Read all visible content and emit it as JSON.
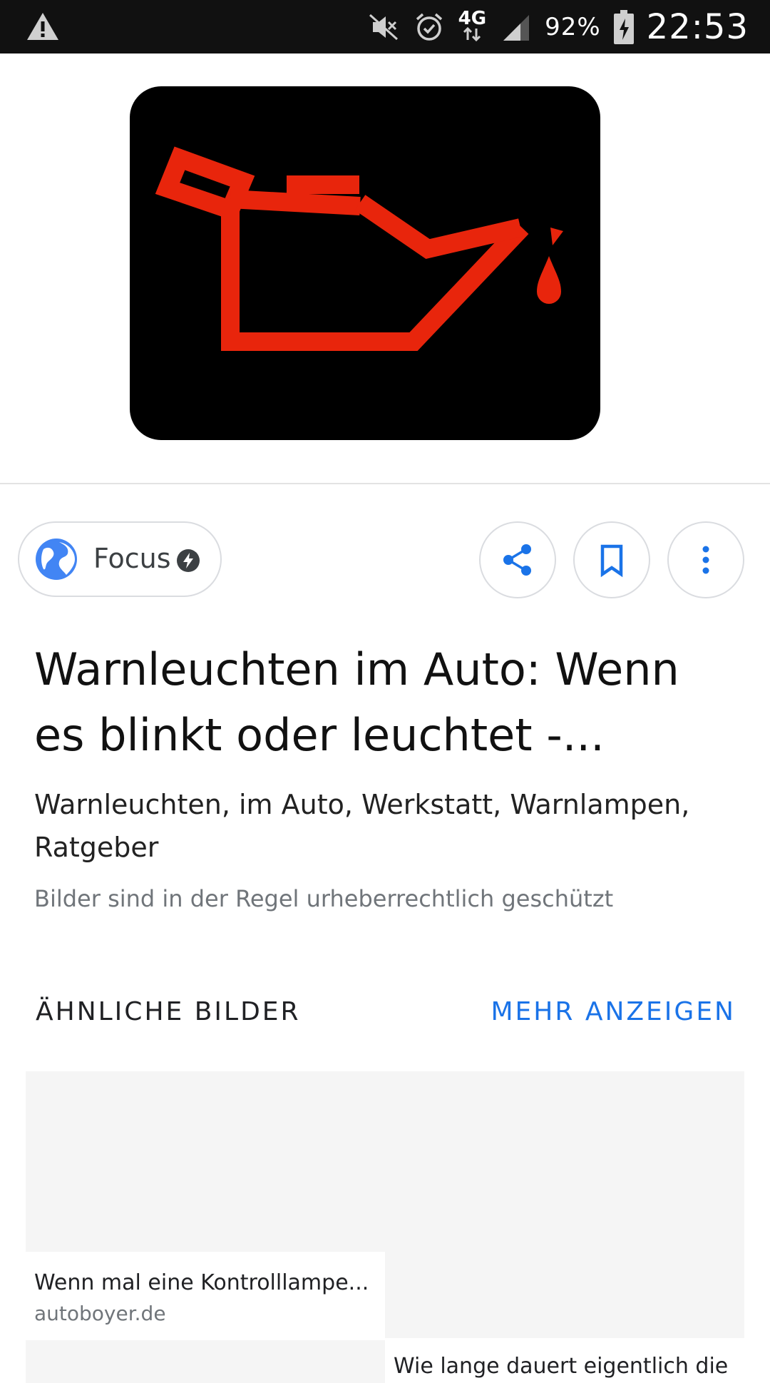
{
  "status_bar": {
    "signal": "4G",
    "battery": "92%",
    "time": "22:53",
    "icons": [
      "warning-icon",
      "mute-icon",
      "alarm-icon",
      "data-arrows-icon",
      "signal-icon",
      "battery-charging-icon"
    ]
  },
  "hero_image": {
    "icon": "oil-pressure-warning-icon",
    "colors": {
      "background": "#000000",
      "symbol": "#e8250c"
    }
  },
  "source": {
    "name": "Focus",
    "icon": "globe-icon",
    "badge_icon": "amp-lightning-icon"
  },
  "actions": {
    "share_icon": "share-icon",
    "bookmark_icon": "bookmark-icon",
    "more_icon": "more-vert-icon"
  },
  "title": {
    "line1": "Warnleuchten im Auto: Wenn",
    "line2": "es blinkt oder leuchtet -..."
  },
  "tags": {
    "line1": "Warnleuchten, im Auto, Werkstatt, Warnlampen,",
    "line2": "Ratgeber"
  },
  "copyright_note": "Bilder sind in der Regel urheberrechtlich geschützt",
  "similar": {
    "heading": "ÄHNLICHE BILDER",
    "more_label": "MEHR ANZEIGEN",
    "cards": [
      {
        "title": "Wenn mal eine Kontrolllampe...",
        "source": "autoboyer.de"
      },
      {
        "title": "Wie lange dauert eigentlich die"
      }
    ]
  },
  "colors": {
    "accent": "#1a73e8",
    "globe": "#4285f4",
    "status_bar": "#111111"
  }
}
